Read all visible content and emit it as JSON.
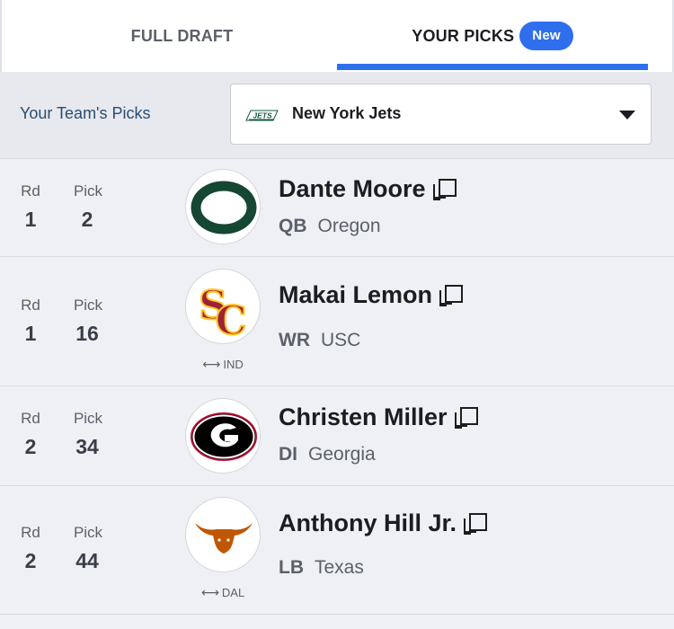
{
  "tabs": {
    "full_draft": "FULL DRAFT",
    "your_picks": "YOUR PICKS",
    "new_badge": "New"
  },
  "team_bar": {
    "label": "Your Team's Picks",
    "selected_team": "New York Jets",
    "team_logo_icon": "jets-logo-icon"
  },
  "columns": {
    "rd": "Rd",
    "pick": "Pick"
  },
  "picks": [
    {
      "rd": "1",
      "pick": "2",
      "name": "Dante Moore",
      "position": "QB",
      "school": "Oregon",
      "trade": "",
      "logo": "oregon-logo-icon"
    },
    {
      "rd": "1",
      "pick": "16",
      "name": "Makai Lemon",
      "position": "WR",
      "school": "USC",
      "trade": "IND",
      "logo": "usc-logo-icon"
    },
    {
      "rd": "2",
      "pick": "34",
      "name": "Christen Miller",
      "position": "DI",
      "school": "Georgia",
      "trade": "",
      "logo": "georgia-logo-icon"
    },
    {
      "rd": "2",
      "pick": "44",
      "name": "Anthony Hill Jr.",
      "position": "LB",
      "school": "Texas",
      "trade": "DAL",
      "logo": "texas-logo-icon"
    }
  ],
  "colors": {
    "accent": "#2f6fed",
    "oregon_green": "#154733",
    "usc_cardinal": "#9d2235",
    "usc_gold": "#ffc72c",
    "georgia_black": "#000000",
    "georgia_red": "#ba0c2f",
    "texas_orange": "#bf5700",
    "jets_green": "#125740"
  }
}
